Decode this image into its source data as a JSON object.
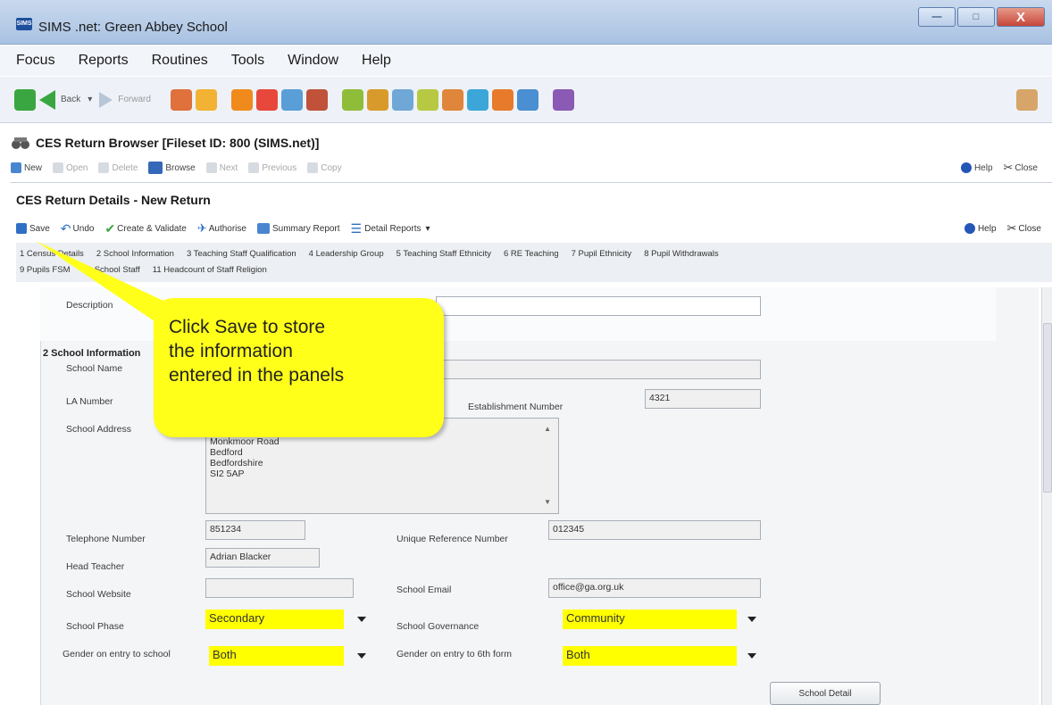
{
  "window": {
    "app_badge": "SIMS",
    "title": "SIMS .net: Green Abbey School",
    "minimize": "—",
    "maximize": "□",
    "close": "X"
  },
  "menu": [
    "Focus",
    "Reports",
    "Routines",
    "Tools",
    "Window",
    "Help"
  ],
  "toolbar": {
    "back_label": "Back",
    "forward_label": "Forward",
    "icon_colors": [
      "#e0703c",
      "#f2b233",
      "#f08a1c",
      "#e8483c",
      "#5a9ed8",
      "#c0523a",
      "#8fbd3a",
      "#d89b2b",
      "#6fa7d6",
      "#b7c943",
      "#e0863a",
      "#3ca6d8",
      "#e87a2c",
      "#4a8fd1",
      "#8a5ab5"
    ]
  },
  "browser": {
    "title": "CES Return Browser [Fileset ID:  800 (SIMS.net)]",
    "new": "New",
    "open": "Open",
    "delete": "Delete",
    "browse": "Browse",
    "next": "Next",
    "previous": "Previous",
    "copy": "Copy",
    "help": "Help",
    "close": "Close"
  },
  "details": {
    "title": "CES Return Details - New Return",
    "save": "Save",
    "undo": "Undo",
    "create_validate": "Create & Validate",
    "authorise": "Authorise",
    "summary_report": "Summary Report",
    "detail_reports": "Detail Reports",
    "help": "Help",
    "close": "Close"
  },
  "tabs_row1": [
    "1 Census Details",
    "2 School Information",
    "3 Teaching Staff Qualification",
    "4 Leadership Group",
    "5 Teaching Staff Ethnicity",
    "6 RE Teaching",
    "7 Pupil Ethnicity",
    "8 Pupil Withdrawals"
  ],
  "tabs_row2": [
    "9 Pupils FSM",
    "10 School Staff",
    "11 Headcount of Staff Religion"
  ],
  "form": {
    "description_label": "Description",
    "description_value": "",
    "section_title": "2 School Information",
    "school_name_label": "School Name",
    "school_name_value": "",
    "la_number_label": "LA Number",
    "establishment_label": "Establishment Number",
    "establishment_value": "4321",
    "address_label": "School Address",
    "address_lines": [
      "Monkmoor Road",
      "Bedford",
      "Bedfordshire",
      "SI2 5AP"
    ],
    "telephone_label": "Telephone Number",
    "telephone_value": "851234",
    "urn_label": "Unique Reference Number",
    "urn_value": "012345",
    "head_label": "Head Teacher",
    "head_value": "Adrian Blacker",
    "website_label": "School Website",
    "website_value": "",
    "email_label": "School Email",
    "email_value": "office@ga.org.uk",
    "phase_label": "School Phase",
    "phase_value": "Secondary",
    "governance_label": "School Governance",
    "governance_value": "Community",
    "gender_label": "Gender on entry to school",
    "gender_value": "Both",
    "gender6_label": "Gender on entry to 6th form",
    "gender6_value": "Both",
    "school_detail_button": "School Detail"
  },
  "callout": {
    "text_line1": "Click Save to store",
    "text_line2": "the information",
    "text_line3": "entered in the panels",
    "color": "#ffff1a"
  }
}
